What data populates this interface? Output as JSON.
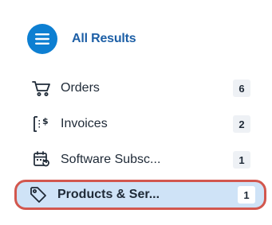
{
  "header": {
    "title": "All Results",
    "icon": "menu-icon",
    "accent_color": "#0d7fd2"
  },
  "items": [
    {
      "label": "Orders",
      "count": "6",
      "icon": "cart-icon"
    },
    {
      "label": "Invoices",
      "count": "2",
      "icon": "invoice-icon"
    },
    {
      "label": "Software Subsc...",
      "count": "1",
      "icon": "subscription-icon"
    },
    {
      "label": "Products & Ser...",
      "count": "1",
      "icon": "tag-icon",
      "selected": true
    }
  ],
  "colors": {
    "selected_bg": "#cfe3f7",
    "highlight_border": "#d2574e",
    "badge_bg": "#eef1f5"
  }
}
